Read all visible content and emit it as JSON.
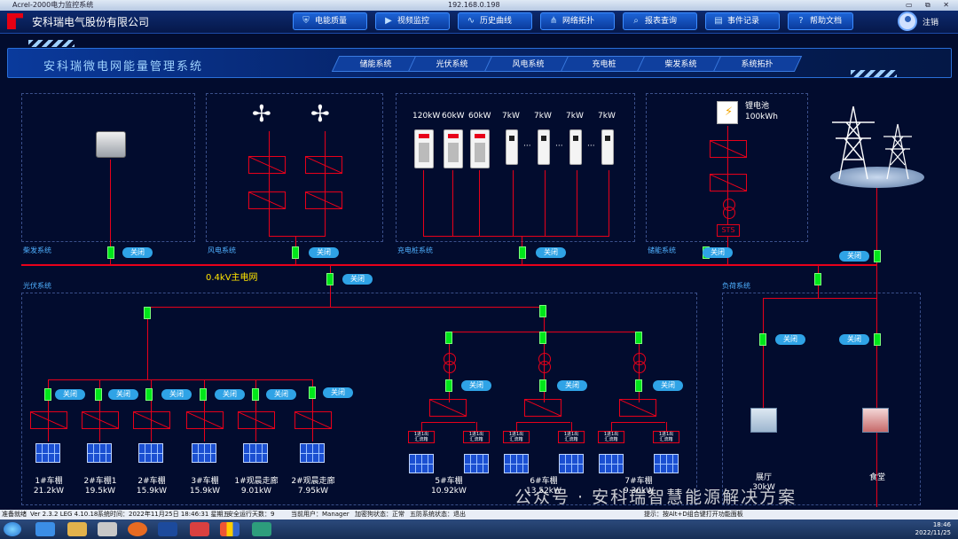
{
  "window": {
    "title": "Acrel-2000电力监控系统",
    "address": "192.168.0.198",
    "controls": "▭ ⧉ ✕"
  },
  "header": {
    "company": "安科瑞电气股份有限公司",
    "logout": "注销",
    "nav": [
      {
        "label": "电能质量",
        "icon": "shield-icon"
      },
      {
        "label": "视频监控",
        "icon": "video-icon"
      },
      {
        "label": "历史曲线",
        "icon": "chart-icon"
      },
      {
        "label": "网络拓扑",
        "icon": "network-icon"
      },
      {
        "label": "报表查询",
        "icon": "search-icon"
      },
      {
        "label": "事件记录",
        "icon": "doc-icon"
      },
      {
        "label": "帮助文档",
        "icon": "help-icon"
      }
    ]
  },
  "title": "安科瑞微电网能量管理系统",
  "subtabs": [
    "储能系统",
    "光伏系统",
    "风电系统",
    "充电桩",
    "柴发系统",
    "系统拓扑"
  ],
  "sections": {
    "diesel": "柴发系统",
    "wind": "风电系统",
    "charging": "充电桩系统",
    "storage": "储能系统",
    "pv": "光伏系统",
    "load": "负荷系统"
  },
  "bus_label": "0.4kV主电网",
  "switch_label": "关闭",
  "charging": {
    "ratings": [
      "120kW",
      "60kW",
      "60kW",
      "7kW",
      "7kW",
      "7kW",
      "7kW"
    ],
    "dots": "···"
  },
  "storage": {
    "name": "锂电池",
    "capacity": "100kWh",
    "sts": "STS"
  },
  "pv_sets": [
    {
      "name": "1#车棚",
      "power": "21.2kW"
    },
    {
      "name": "2#车棚1",
      "power": "19.5kW"
    },
    {
      "name": "2#车棚",
      "power": "15.9kW"
    },
    {
      "name": "3#车棚",
      "power": "15.9kW"
    },
    {
      "name": "1#观晨走廊",
      "power": "9.01kW"
    },
    {
      "name": "2#观晨走廊",
      "power": "7.95kW"
    }
  ],
  "pv_groups": [
    {
      "name": "5#车棚",
      "power": "10.92kW",
      "boxes": [
        "1进1出\n汇流箱",
        "1进1出\n汇流箱"
      ]
    },
    {
      "name": "6#车棚",
      "power": "13.52kW",
      "boxes": [
        "1进1出\n汇流箱",
        "1进1出\n汇流箱"
      ]
    },
    {
      "name": "7#车棚",
      "power": "9.36kW",
      "boxes": [
        "1进1出\n汇流箱",
        "1进1出\n汇流箱"
      ]
    }
  ],
  "loads": [
    {
      "name": "展厅",
      "power": "30kW"
    },
    {
      "name": "食堂",
      "power": ""
    }
  ],
  "status": {
    "ready": "准备就绪",
    "ver": "Ver 2.3.2 LEG 4.10.18",
    "time": "系统时间：2022年11月25日 18:46:31 星期五",
    "days": "安全运行天数：9",
    "user": "当前用户：Manager",
    "db": "加密狗状态：正常",
    "five": "五防系统状态：退出",
    "hint": "提示：按Alt+D组合键打开功能面板"
  },
  "clock": {
    "time": "18:46",
    "date": "2022/11/25"
  },
  "watermark": "公众号 · 安科瑞智慧能源解决方案"
}
